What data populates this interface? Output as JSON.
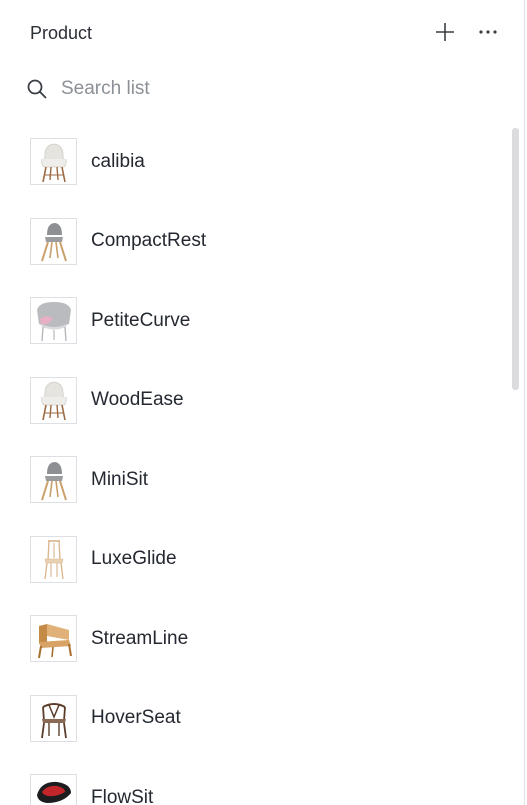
{
  "header": {
    "title": "Product",
    "add_icon": "plus-icon",
    "more_icon": "more-horizontal-icon"
  },
  "search": {
    "placeholder": "Search list",
    "value": "",
    "icon": "search-icon"
  },
  "products": [
    {
      "name": "calibia",
      "thumb": "white-armchair-chair"
    },
    {
      "name": "CompactRest",
      "thumb": "grey-scandinavian-chair"
    },
    {
      "name": "PetiteCurve",
      "thumb": "grey-pink-tub-chair"
    },
    {
      "name": "WoodEase",
      "thumb": "white-armchair-chair"
    },
    {
      "name": "MiniSit",
      "thumb": "grey-scandinavian-chair"
    },
    {
      "name": "LuxeGlide",
      "thumb": "light-wood-high-back-chair"
    },
    {
      "name": "StreamLine",
      "thumb": "wood-lounge-chair"
    },
    {
      "name": "HoverSeat",
      "thumb": "dark-wishbone-chair"
    },
    {
      "name": "FlowSit",
      "thumb": "red-black-shell-chair"
    }
  ],
  "colors": {
    "text": "#242830",
    "placeholder": "#8b9097",
    "border": "#dcdfe3",
    "scrollbar": "#dcdcdf"
  }
}
